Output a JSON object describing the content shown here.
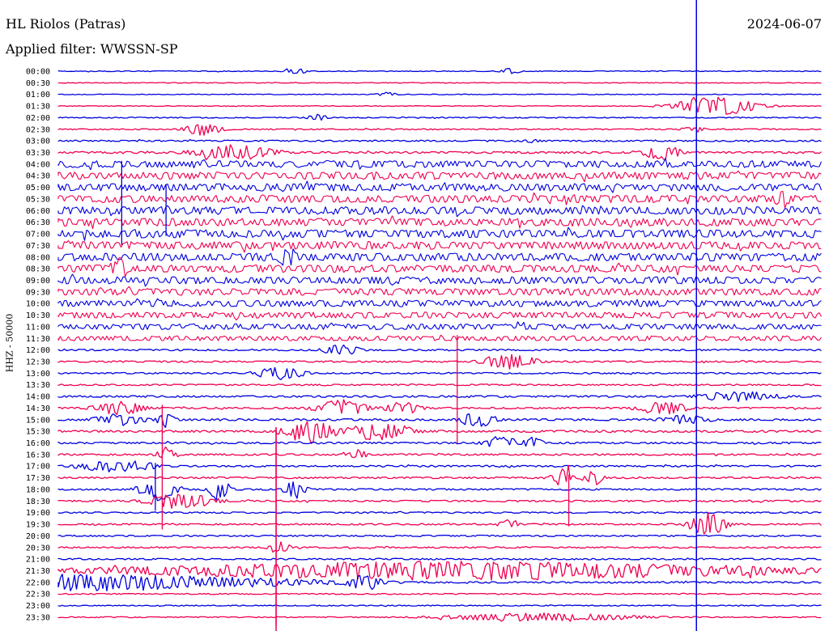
{
  "header": {
    "station": "HL Riolos (Patras)",
    "date": "2024-06-07",
    "filter_label": "Applied filter: WWSSN-SP"
  },
  "chart_data": {
    "type": "helicorder",
    "title": "HL Riolos (Patras)",
    "date": "2024-06-07",
    "filter": "WWSSN-SP",
    "ylabel": "HHZ - 50000",
    "trace_colors": [
      "#0000e0",
      "#f00050"
    ],
    "marker_color": "#0000e0",
    "row_labels": [
      "00:00",
      "00:30",
      "01:00",
      "01:30",
      "02:00",
      "02:30",
      "03:00",
      "03:30",
      "04:00",
      "04:30",
      "05:00",
      "05:30",
      "06:00",
      "06:30",
      "07:00",
      "07:30",
      "08:00",
      "08:30",
      "09:00",
      "09:30",
      "10:00",
      "10:30",
      "11:00",
      "11:30",
      "12:00",
      "12:30",
      "13:00",
      "13:30",
      "14:00",
      "14:30",
      "15:00",
      "15:30",
      "16:00",
      "16:30",
      "17:00",
      "17:30",
      "18:00",
      "18:30",
      "19:00",
      "19:30",
      "20:00",
      "20:30",
      "21:00",
      "21:30",
      "22:00",
      "22:30",
      "23:00",
      "23:30"
    ],
    "noise_level": [
      0.5,
      0.4,
      0.4,
      0.4,
      0.6,
      0.7,
      0.9,
      1.2,
      4.2,
      4.5,
      4.6,
      4.6,
      4.8,
      4.8,
      4.9,
      4.8,
      4.8,
      4.6,
      4.4,
      4.2,
      4.0,
      3.8,
      3.5,
      3.0,
      1.0,
      0.9,
      0.9,
      0.9,
      1.1,
      1.0,
      1.2,
      1.3,
      1.1,
      1.0,
      1.0,
      1.0,
      1.0,
      1.0,
      0.9,
      0.9,
      0.9,
      0.9,
      0.9,
      1.0,
      1.0,
      0.7,
      0.6,
      0.6
    ],
    "events": [
      {
        "row": 0,
        "t": 0.31,
        "amp": 5,
        "dur": 0.01
      },
      {
        "row": 0,
        "t": 0.59,
        "amp": 4,
        "dur": 0.01
      },
      {
        "row": 2,
        "t": 0.43,
        "amp": 3,
        "dur": 0.01
      },
      {
        "row": 3,
        "t": 0.86,
        "amp": 12,
        "dur": 0.05
      },
      {
        "row": 4,
        "t": 0.34,
        "amp": 5,
        "dur": 0.01
      },
      {
        "row": 5,
        "t": 0.19,
        "amp": 9,
        "dur": 0.02
      },
      {
        "row": 5,
        "t": 0.83,
        "amp": 5,
        "dur": 0.01
      },
      {
        "row": 6,
        "t": 0.62,
        "amp": 3,
        "dur": 0.01
      },
      {
        "row": 7,
        "t": 0.23,
        "amp": 10,
        "dur": 0.05
      },
      {
        "row": 7,
        "t": 0.79,
        "amp": 11,
        "dur": 0.02
      },
      {
        "row": 11,
        "t": 0.95,
        "amp": 14,
        "dur": 0.01
      },
      {
        "row": 16,
        "t": 0.3,
        "amp": 14,
        "dur": 0.01
      },
      {
        "row": 17,
        "t": 0.08,
        "amp": 14,
        "dur": 0.01
      },
      {
        "row": 24,
        "t": 0.37,
        "amp": 8,
        "dur": 0.02
      },
      {
        "row": 25,
        "t": 0.59,
        "amp": 11,
        "dur": 0.03
      },
      {
        "row": 26,
        "t": 0.29,
        "amp": 8,
        "dur": 0.03
      },
      {
        "row": 28,
        "t": 0.89,
        "amp": 7,
        "dur": 0.05
      },
      {
        "row": 29,
        "t": 0.08,
        "amp": 9,
        "dur": 0.03
      },
      {
        "row": 29,
        "t": 0.37,
        "amp": 11,
        "dur": 0.03
      },
      {
        "row": 29,
        "t": 0.45,
        "amp": 9,
        "dur": 0.02
      },
      {
        "row": 29,
        "t": 0.79,
        "amp": 9,
        "dur": 0.03
      },
      {
        "row": 30,
        "t": 0.08,
        "amp": 8,
        "dur": 0.03
      },
      {
        "row": 30,
        "t": 0.14,
        "amp": 10,
        "dur": 0.01
      },
      {
        "row": 30,
        "t": 0.55,
        "amp": 10,
        "dur": 0.02
      },
      {
        "row": 30,
        "t": 0.82,
        "amp": 6,
        "dur": 0.03
      },
      {
        "row": 31,
        "t": 0.33,
        "amp": 16,
        "dur": 0.03
      },
      {
        "row": 31,
        "t": 0.42,
        "amp": 12,
        "dur": 0.04
      },
      {
        "row": 32,
        "t": 0.58,
        "amp": 9,
        "dur": 0.02
      },
      {
        "row": 32,
        "t": 0.62,
        "amp": 8,
        "dur": 0.01
      },
      {
        "row": 33,
        "t": 0.14,
        "amp": 10,
        "dur": 0.01
      },
      {
        "row": 33,
        "t": 0.39,
        "amp": 7,
        "dur": 0.01
      },
      {
        "row": 34,
        "t": 0.08,
        "amp": 8,
        "dur": 0.05
      },
      {
        "row": 35,
        "t": 0.66,
        "amp": 12,
        "dur": 0.01
      },
      {
        "row": 35,
        "t": 0.7,
        "amp": 10,
        "dur": 0.01
      },
      {
        "row": 36,
        "t": 0.13,
        "amp": 14,
        "dur": 0.02
      },
      {
        "row": 36,
        "t": 0.21,
        "amp": 16,
        "dur": 0.01
      },
      {
        "row": 36,
        "t": 0.31,
        "amp": 12,
        "dur": 0.01
      },
      {
        "row": 37,
        "t": 0.16,
        "amp": 12,
        "dur": 0.04
      },
      {
        "row": 39,
        "t": 0.85,
        "amp": 16,
        "dur": 0.02
      },
      {
        "row": 39,
        "t": 0.59,
        "amp": 8,
        "dur": 0.01
      },
      {
        "row": 41,
        "t": 0.29,
        "amp": 9,
        "dur": 0.01
      },
      {
        "row": 43,
        "t": 0.53,
        "amp": 12,
        "dur": 0.45
      },
      {
        "row": 44,
        "t": 0.03,
        "amp": 11,
        "dur": 0.29
      },
      {
        "row": 44,
        "t": 0.4,
        "amp": 11,
        "dur": 0.02
      },
      {
        "row": 47,
        "t": 0.63,
        "amp": 6,
        "dur": 0.12
      }
    ],
    "spikes": [
      {
        "row": 8,
        "t": 0.083,
        "down": 100
      },
      {
        "row": 10,
        "t": 0.141,
        "down": 60
      },
      {
        "row": 23,
        "t": 0.522,
        "down": 130
      },
      {
        "row": 29,
        "t": 0.136,
        "down": 150
      },
      {
        "row": 31,
        "t": 0.285,
        "down": 240
      },
      {
        "row": 34,
        "t": 0.127,
        "down": 55
      },
      {
        "row": 35,
        "t": 0.668,
        "down": 60
      }
    ],
    "marker": {
      "row": 0,
      "t": 0.835
    }
  }
}
